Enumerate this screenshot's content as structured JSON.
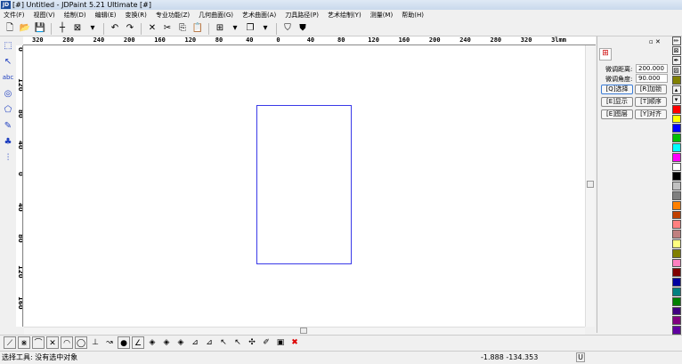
{
  "window": {
    "title": "[#] Untitled - JDPaint 5.21 Ultimate [#]",
    "logo": "JD"
  },
  "menu": [
    "文件(F)",
    "视图(V)",
    "绘制(D)",
    "编辑(E)",
    "变换(R)",
    "专业功能(Z)",
    "几何曲面(G)",
    "艺术曲面(A)",
    "刀具路径(P)",
    "艺术绘制(Y)",
    "测量(M)",
    "帮助(H)"
  ],
  "toolbar": [
    {
      "icon": "new-file-icon",
      "g": "🗋"
    },
    {
      "icon": "open-folder-icon",
      "g": "📂"
    },
    {
      "icon": "save-icon",
      "g": "💾"
    },
    {
      "icon": "crosshair-icon",
      "g": "┼"
    },
    {
      "icon": "select-box-icon",
      "g": "⊠"
    },
    {
      "icon": "dropdown-icon",
      "g": "▾"
    },
    {
      "icon": "undo-icon",
      "g": "↶"
    },
    {
      "icon": "redo-icon",
      "g": "↷"
    },
    {
      "icon": "delete-icon",
      "g": "✕"
    },
    {
      "icon": "cut-icon",
      "g": "✂"
    },
    {
      "icon": "copy-icon",
      "g": "⎘"
    },
    {
      "icon": "paste-icon",
      "g": "📋"
    },
    {
      "icon": "grid-icon",
      "g": "⊞"
    },
    {
      "icon": "dropdown-icon",
      "g": "▾"
    },
    {
      "icon": "layers-icon",
      "g": "❐"
    },
    {
      "icon": "dropdown-icon",
      "g": "▾"
    },
    {
      "icon": "shield-icon",
      "g": "⛉"
    },
    {
      "icon": "shield-filled-icon",
      "g": "⛊"
    }
  ],
  "h_ruler": [
    "320",
    "280",
    "240",
    "200",
    "160",
    "120",
    "80",
    "40",
    "0",
    "40",
    "80",
    "120",
    "160",
    "200",
    "240",
    "280",
    "320",
    "3lmm"
  ],
  "v_ruler": [
    "0",
    "120",
    "80",
    "40",
    "0",
    "40",
    "80",
    "120",
    "160",
    "20"
  ],
  "left_tools": [
    {
      "icon": "select-tool-icon",
      "g": "⬚"
    },
    {
      "icon": "node-edit-icon",
      "g": "↖"
    },
    {
      "icon": "text-tool-icon",
      "g": "abc"
    },
    {
      "icon": "transform-icon",
      "g": "◎"
    },
    {
      "icon": "polygon-icon",
      "g": "⬠"
    },
    {
      "icon": "eraser-icon",
      "g": "✎"
    },
    {
      "icon": "tree-icon",
      "g": "♣"
    },
    {
      "icon": "tool-path-icon",
      "g": "⫶"
    }
  ],
  "panel": {
    "distance_label": "微调距离:",
    "distance_value": "200.000",
    "angle_label": "微调角度:",
    "angle_value": "90.000",
    "buttons": [
      "[Q]选择",
      "[R]加锁",
      "[E]显示",
      "[T]顺序",
      "[E]图层",
      "[Y]对齐"
    ]
  },
  "palette": [
    "#ff0000",
    "#ffff00",
    "#0000ff",
    "#00c000",
    "#00ffff",
    "#ff00ff",
    "#ffffff",
    "#000000",
    "#c0c0c0",
    "#808080",
    "#ff8000",
    "#c04000",
    "#ff8080",
    "#c08080",
    "#ffff80",
    "#808000",
    "#ff80c0",
    "#800000",
    "#0000a0",
    "#008080",
    "#008000",
    "#400080",
    "#800080",
    "#6000a0"
  ],
  "palette_top": [
    {
      "icon": "pencil-icon",
      "g": "✏"
    },
    {
      "icon": "no-color-icon",
      "g": "⊠"
    },
    {
      "icon": "eyedropper-icon",
      "g": "✒"
    },
    {
      "icon": "color-edit-icon",
      "g": "▨"
    },
    {
      "icon": "olive-swatch-icon",
      "g": ""
    },
    {
      "icon": "scroll-up-icon",
      "g": "▴"
    },
    {
      "icon": "scroll-down-icon",
      "g": "▾"
    }
  ],
  "bottom_tools": [
    {
      "icon": "line-icon",
      "g": "⟋"
    },
    {
      "icon": "point-snap-icon",
      "g": "⋇"
    },
    {
      "icon": "arc-icon",
      "g": "⌒"
    },
    {
      "icon": "intersect-icon",
      "g": "✕"
    },
    {
      "icon": "arc-tangent-icon",
      "g": "◠"
    },
    {
      "icon": "circle-snap-icon",
      "g": "◯"
    },
    {
      "icon": "perpendicular-icon",
      "g": "⊥"
    },
    {
      "icon": "tangent-icon",
      "g": "↝"
    },
    {
      "icon": "center-point-icon",
      "g": "●"
    },
    {
      "icon": "angle-icon",
      "g": "∠"
    },
    {
      "icon": "diamond-icon",
      "g": "◈"
    },
    {
      "icon": "diamond-icon",
      "g": "◈"
    },
    {
      "icon": "diamond-icon",
      "g": "◈"
    },
    {
      "icon": "align-icon",
      "g": "⊿"
    },
    {
      "icon": "align-icon",
      "g": "⊿"
    },
    {
      "icon": "cursor-x-icon",
      "g": "↖"
    },
    {
      "icon": "cursor-x-icon",
      "g": "↖"
    },
    {
      "icon": "snap-node-icon",
      "g": "✣"
    },
    {
      "icon": "snap-edit-icon",
      "g": "✐"
    },
    {
      "icon": "snap-box-icon",
      "g": "▣"
    },
    {
      "icon": "close-red-icon",
      "g": "✖"
    }
  ],
  "status": {
    "message": "选择工具: 没有选中对象",
    "coords": "-1.888 -134.353",
    "mode": "U"
  }
}
